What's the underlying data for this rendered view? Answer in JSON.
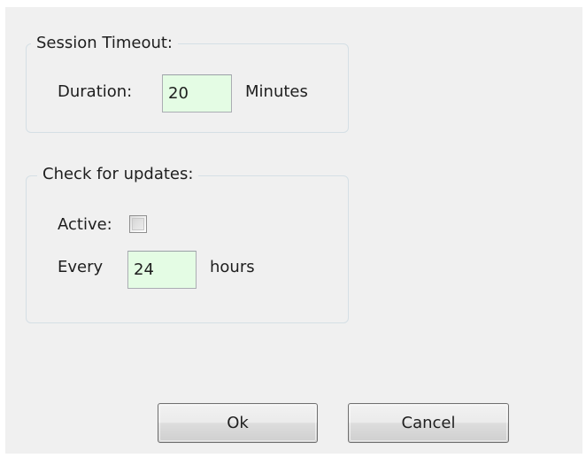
{
  "session_timeout": {
    "title": "Session Timeout:",
    "duration_label": "Duration:",
    "duration_value": "20",
    "unit_label": "Minutes"
  },
  "updates": {
    "title": "Check for updates:",
    "active_label": "Active:",
    "active_checked": false,
    "every_label": "Every",
    "every_value": "24",
    "unit_label": "hours"
  },
  "buttons": {
    "ok_label": "Ok",
    "cancel_label": "Cancel"
  },
  "colors": {
    "field_background": "#e4fce4",
    "dialog_background": "#f0f0f0",
    "groupbox_border": "#d5dfe5"
  }
}
